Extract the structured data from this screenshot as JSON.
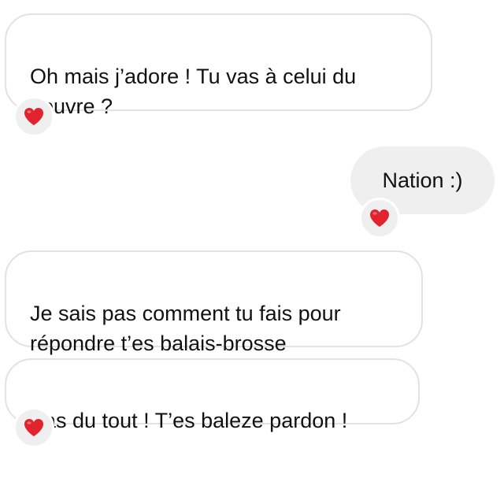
{
  "messages": [
    {
      "direction": "received",
      "text": "Oh mais j’adore ! Tu vas à celui du\nLouvre ?",
      "reaction": "heart"
    },
    {
      "direction": "sent",
      "text": "Nation :)",
      "reaction": "heart"
    },
    {
      "direction": "received",
      "text": "Je sais pas comment tu fais pour\nrépondre t’es balais-brosse",
      "reaction": null
    },
    {
      "direction": "received",
      "text": "Pas du tout ! T’es baleze pardon !",
      "reaction": "heart"
    }
  ],
  "colors": {
    "sent_bubble": "#efefef",
    "received_border": "#e2e2e2",
    "heart": "#e0232e"
  }
}
